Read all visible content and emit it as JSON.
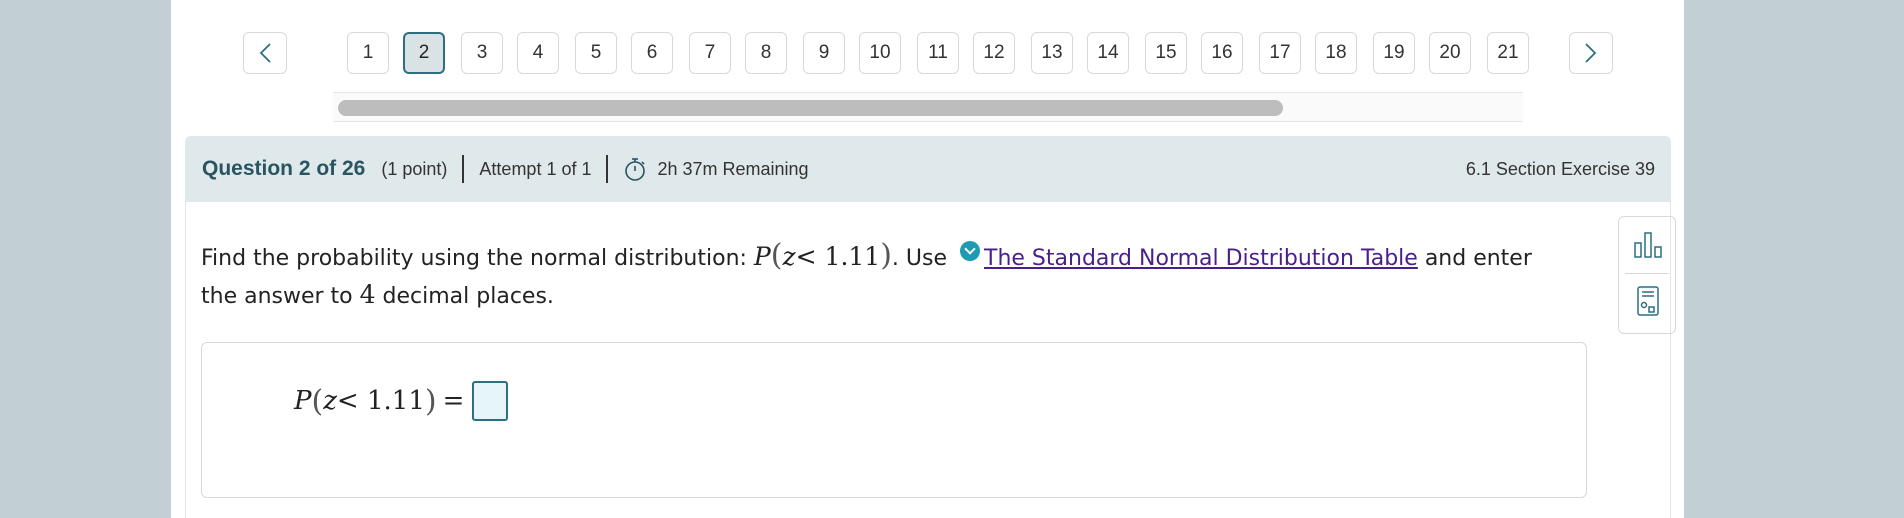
{
  "pagination": {
    "pages": [
      "1",
      "2",
      "3",
      "4",
      "5",
      "6",
      "7",
      "8",
      "9",
      "10",
      "11",
      "12",
      "13",
      "14",
      "15",
      "16",
      "17",
      "18",
      "19",
      "20",
      "21"
    ],
    "active_page": "2"
  },
  "header": {
    "title": "Question 2 of 26",
    "points": "(1 point)",
    "attempt": "Attempt 1 of 1",
    "remaining": "2h 37m Remaining",
    "section": "6.1 Section Exercise 39"
  },
  "question": {
    "prompt_prefix": "Find the probability using the normal distribution: ",
    "math_P": "P",
    "math_open": "(",
    "math_var": "z",
    "math_body": "< 1.11",
    "math_close": ")",
    "use_text": ". Use",
    "link_text": "The Standard Normal Distribution Table",
    "prompt_suffix_1": " and enter the answer to ",
    "digits": "4",
    "prompt_suffix_2": " decimal places."
  },
  "answer": {
    "lhs_P": "P",
    "lhs_open": "(",
    "lhs_var": "z",
    "lhs_body": "< 1.11",
    "lhs_close": ")",
    "equals": "=",
    "value": ""
  },
  "colors": {
    "accent": "#2d6e80",
    "header_bg": "#dfe8ea",
    "link": "#4a1f8a",
    "help_icon": "#1c9bb3"
  },
  "icons": {
    "prev": "chevron-left-icon",
    "next": "chevron-right-icon",
    "timer": "stopwatch-icon",
    "help": "chevron-down-circle-icon",
    "chart_tool": "bar-chart-icon",
    "calc_tool": "calculator-icon"
  }
}
